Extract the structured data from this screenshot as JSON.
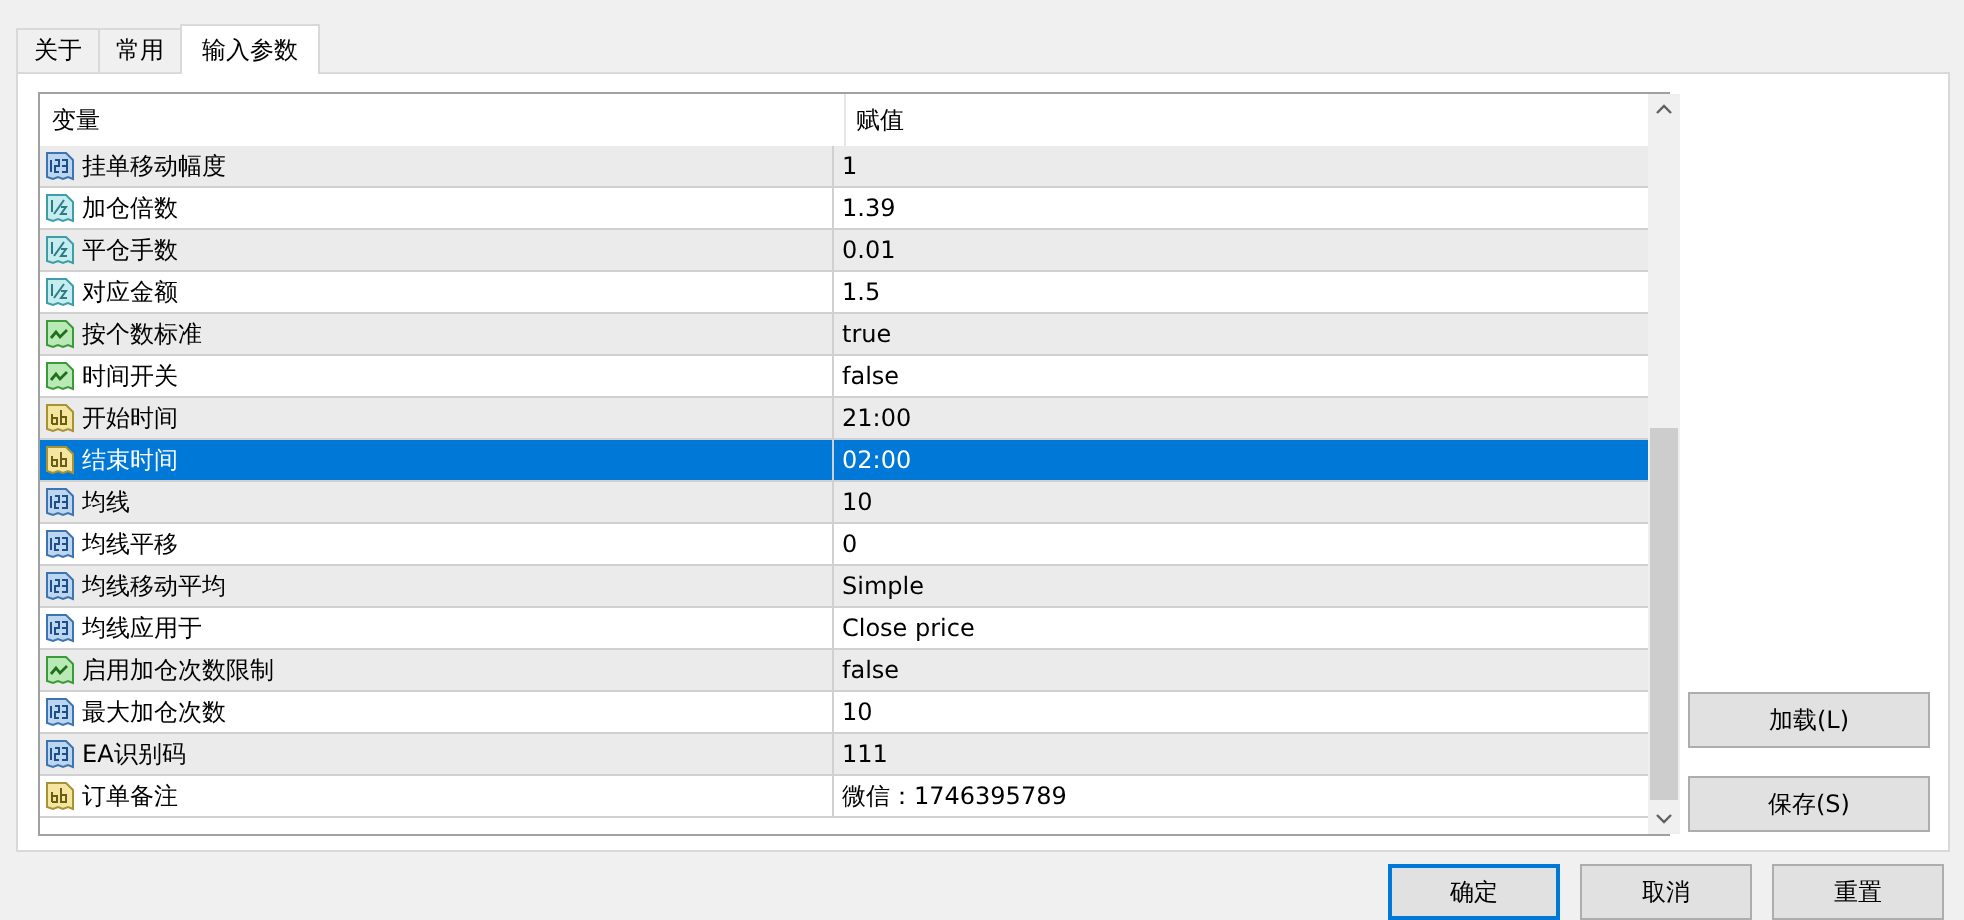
{
  "tabs": [
    {
      "label": "关于",
      "selected": false
    },
    {
      "label": "常用",
      "selected": false
    },
    {
      "label": "输入参数",
      "selected": true
    }
  ],
  "table": {
    "columns": [
      "变量",
      "赋值"
    ],
    "rows": [
      {
        "kind": "int",
        "name": "挂单移动幅度",
        "value": "1",
        "selected": false
      },
      {
        "kind": "double",
        "name": "加仓倍数",
        "value": "1.39",
        "selected": false
      },
      {
        "kind": "double",
        "name": "平仓手数",
        "value": "0.01",
        "selected": false
      },
      {
        "kind": "double",
        "name": "对应金额",
        "value": "1.5",
        "selected": false
      },
      {
        "kind": "bool",
        "name": "按个数标准",
        "value": "true",
        "selected": false
      },
      {
        "kind": "bool",
        "name": "时间开关",
        "value": "false",
        "selected": false
      },
      {
        "kind": "string",
        "name": "开始时间",
        "value": "21:00",
        "selected": false
      },
      {
        "kind": "string",
        "name": "结束时间",
        "value": "02:00",
        "selected": true
      },
      {
        "kind": "int",
        "name": "均线",
        "value": "10",
        "selected": false
      },
      {
        "kind": "int",
        "name": "均线平移",
        "value": "0",
        "selected": false
      },
      {
        "kind": "int",
        "name": "均线移动平均",
        "value": "Simple",
        "selected": false
      },
      {
        "kind": "int",
        "name": "均线应用于",
        "value": "Close price",
        "selected": false
      },
      {
        "kind": "bool",
        "name": "启用加仓次数限制",
        "value": "false",
        "selected": false
      },
      {
        "kind": "int",
        "name": "最大加仓次数",
        "value": "10",
        "selected": false
      },
      {
        "kind": "int",
        "name": "EA识别码",
        "value": "111",
        "selected": false
      },
      {
        "kind": "string",
        "name": "订单备注",
        "value": "微信：1746395789",
        "selected": false
      }
    ]
  },
  "side_buttons": [
    "加载(L)",
    "保存(S)"
  ],
  "dialog_buttons": [
    {
      "label": "确定",
      "default": true
    },
    {
      "label": "取消",
      "default": false
    },
    {
      "label": "重置",
      "default": false
    }
  ]
}
